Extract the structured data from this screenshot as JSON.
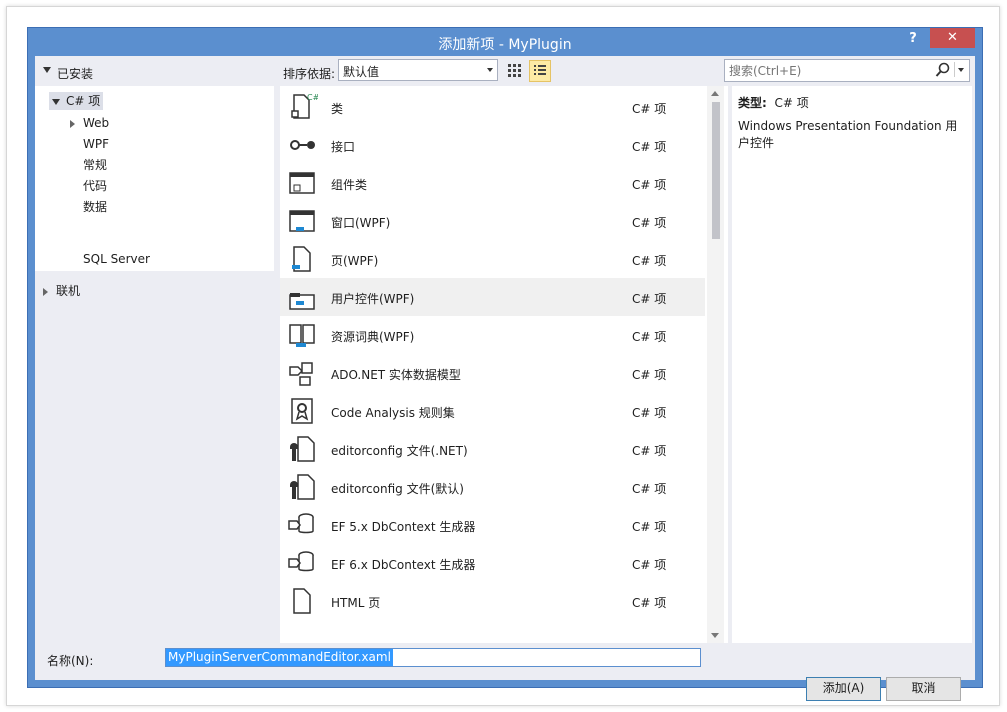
{
  "window": {
    "title": "添加新项 - MyPlugin",
    "help": "?",
    "close": "✕"
  },
  "tree": {
    "installed_label": "已安装",
    "items": [
      {
        "label": "C# 项"
      },
      {
        "label": "Web"
      },
      {
        "label": "WPF"
      },
      {
        "label": "常规"
      },
      {
        "label": "代码"
      },
      {
        "label": "数据"
      },
      {
        "label": "SQL Server"
      }
    ],
    "online_label": "联机"
  },
  "toolbar": {
    "sort_label": "排序依据:",
    "sort_value": "默认值",
    "search_placeholder": "搜索(Ctrl+E)"
  },
  "items": [
    {
      "name": "类",
      "category": "C# 项",
      "icon": "class-icon"
    },
    {
      "name": "接口",
      "category": "C# 项",
      "icon": "interface-icon"
    },
    {
      "name": "组件类",
      "category": "C# 项",
      "icon": "component-class-icon"
    },
    {
      "name": "窗口(WPF)",
      "category": "C# 项",
      "icon": "wpf-window-icon"
    },
    {
      "name": "页(WPF)",
      "category": "C# 项",
      "icon": "wpf-page-icon"
    },
    {
      "name": "用户控件(WPF)",
      "category": "C# 项",
      "icon": "wpf-user-control-icon"
    },
    {
      "name": "资源词典(WPF)",
      "category": "C# 项",
      "icon": "resource-dictionary-icon"
    },
    {
      "name": "ADO.NET 实体数据模型",
      "category": "C# 项",
      "icon": "entity-model-icon"
    },
    {
      "name": "Code Analysis 规则集",
      "category": "C# 项",
      "icon": "ruleset-icon"
    },
    {
      "name": "editorconfig 文件(.NET)",
      "category": "C# 项",
      "icon": "editorconfig-icon"
    },
    {
      "name": "editorconfig 文件(默认)",
      "category": "C# 项",
      "icon": "editorconfig-icon"
    },
    {
      "name": "EF 5.x DbContext 生成器",
      "category": "C# 项",
      "icon": "dbcontext-generator-icon"
    },
    {
      "name": "EF 6.x DbContext 生成器",
      "category": "C# 项",
      "icon": "dbcontext-generator-icon"
    },
    {
      "name": "HTML 页",
      "category": "C# 项",
      "icon": "html-page-icon"
    }
  ],
  "description": {
    "type_label": "类型:",
    "type_value": "C# 项",
    "text": "Windows Presentation Foundation 用户控件"
  },
  "footer": {
    "name_label": "名称(N):",
    "name_value": "MyPluginServerCommandEditor.xaml",
    "add_button": "添加(A)",
    "cancel_button": "取消"
  },
  "colors": {
    "title_bar": "#5b8fcf",
    "close": "#c75050",
    "selection": "#3399ff"
  }
}
